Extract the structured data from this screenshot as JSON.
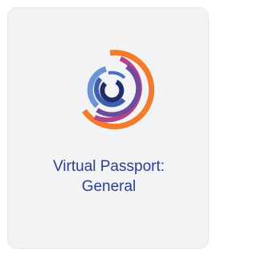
{
  "card": {
    "title_line1": "Virtual Passport:",
    "title_line2": "General",
    "logo_icon": "virtual-passport-logo-icon",
    "colors": {
      "title": "#2c3e8f",
      "arc_orange": "#f47b2a",
      "arc_magenta": "#b2438c",
      "arc_purple": "#6d4c9c",
      "arc_light_blue": "#6a93d8",
      "arc_mid_blue": "#3d5fb0",
      "arc_navy": "#1f2b6b",
      "card_background": "#f2f3f5"
    }
  }
}
